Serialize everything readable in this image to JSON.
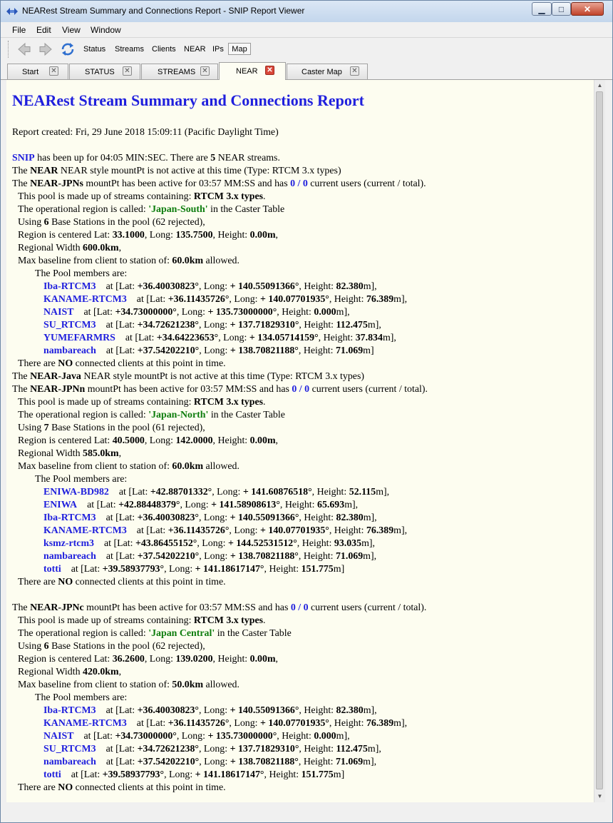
{
  "window": {
    "title": "NEARest Stream Summary and Connections Report - SNIP Report Viewer",
    "min_glyph": "▁",
    "max_glyph": "□",
    "close_glyph": "✕"
  },
  "menu": [
    "File",
    "Edit",
    "View",
    "Window"
  ],
  "toolbar": {
    "links": [
      "Status",
      "Streams",
      "Clients",
      "NEAR",
      "IPs"
    ],
    "map_label": "Map"
  },
  "tabs": [
    {
      "label": "Start",
      "active": false
    },
    {
      "label": "STATUS",
      "active": false
    },
    {
      "label": "STREAMS",
      "active": false
    },
    {
      "label": "NEAR",
      "active": true
    },
    {
      "label": "Caster Map",
      "active": false
    }
  ],
  "report": {
    "title": "NEARest Stream Summary and Connections Report",
    "created": "Report created: Fri, 29 June 2018 15:09:11 (Pacific Daylight Time)",
    "uptime": {
      "snip": "SNIP",
      "t1": " has been up for 04:05 MIN:SEC. There are ",
      "count": "5",
      "t2": " NEAR streams."
    },
    "inactive_near": {
      "a": "The ",
      "name": "NEAR",
      "b": " NEAR style mountPt is not active at this time (Type: RTCM 3.x types)"
    },
    "inactive_java": {
      "a": "The ",
      "name": "NEAR-Java",
      "b": " NEAR style mountPt is not active at this time (Type: RTCM 3.x types)"
    },
    "pools": [
      {
        "a": "The ",
        "name": "NEAR-JPNs",
        "b": " mountPt has been active for 03:57 MM:SS and has ",
        "users": "0 / 0",
        "c": " current users (current / total).",
        "types_a": "This pool is made up of streams containing: ",
        "types": "RTCM 3.x types",
        "types_b": ".",
        "region_a": "The operational region is called: ",
        "region": "'Japan-South'",
        "region_b": " in the Caster Table",
        "using_a": "Using ",
        "using_n": "6",
        "using_b": " Base Stations in the pool (62 rejected),",
        "center_a": "Region is centered Lat: ",
        "lat": "33.1000",
        "center_b": ", Long: ",
        "lon": "135.7500",
        "center_c": ", Height: ",
        "h": "0.00m",
        "center_d": ",",
        "width_a": "Regional Width ",
        "width": "600.0km",
        "width_b": ",",
        "base_a": "Max baseline from client to station of: ",
        "base": "60.0km",
        "base_b": " allowed.",
        "members_label": "The Pool members are:",
        "members": [
          {
            "name": "Iba-RTCM3",
            "lat": "+36.40030823°",
            "lon": "+ 140.55091366°",
            "h": "82.380",
            "end": "],"
          },
          {
            "name": "KANAME-RTCM3",
            "lat": "+36.11435726°",
            "lon": "+ 140.07701935°",
            "h": "76.389",
            "end": "],"
          },
          {
            "name": "NAIST",
            "lat": "+34.73000000°",
            "lon": "+ 135.73000000°",
            "h": "0.000",
            "end": "],"
          },
          {
            "name": "SU_RTCM3",
            "lat": "+34.72621238°",
            "lon": "+ 137.71829310°",
            "h": "112.475",
            "end": "],"
          },
          {
            "name": "YUMEFARMRS",
            "lat": "+34.64223653°",
            "lon": "+ 134.05714159°",
            "h": "37.834",
            "end": "],"
          },
          {
            "name": "nambareach",
            "lat": "+37.54202210°",
            "lon": "+ 138.70821188°",
            "h": "71.069",
            "end": "]"
          }
        ],
        "none_a": "There are ",
        "none": "NO",
        "none_b": " connected clients at this point in time."
      },
      {
        "a": "The ",
        "name": "NEAR-JPNn",
        "b": " mountPt has been active for 03:57 MM:SS and has ",
        "users": "0 / 0",
        "c": " current users (current / total).",
        "types_a": "This pool is made up of streams containing: ",
        "types": "RTCM 3.x types",
        "types_b": ".",
        "region_a": "The operational region is called: ",
        "region": "'Japan-North'",
        "region_b": " in the Caster Table",
        "using_a": "Using ",
        "using_n": "7",
        "using_b": " Base Stations in the pool (61 rejected),",
        "center_a": "Region is centered Lat: ",
        "lat": "40.5000",
        "center_b": ", Long: ",
        "lon": "142.0000",
        "center_c": ", Height: ",
        "h": "0.00m",
        "center_d": ",",
        "width_a": "Regional Width ",
        "width": "585.0km",
        "width_b": ",",
        "base_a": "Max baseline from client to station of: ",
        "base": "60.0km",
        "base_b": " allowed.",
        "members_label": "The Pool members are:",
        "members": [
          {
            "name": "ENIWA-BD982",
            "lat": "+42.88701332°",
            "lon": "+ 141.60876518°",
            "h": "52.115",
            "end": "],"
          },
          {
            "name": "ENIWA",
            "lat": "+42.88448379°",
            "lon": "+ 141.58908613°",
            "h": "65.693",
            "end": "],"
          },
          {
            "name": "Iba-RTCM3",
            "lat": "+36.40030823°",
            "lon": "+ 140.55091366°",
            "h": "82.380",
            "end": "],"
          },
          {
            "name": "KANAME-RTCM3",
            "lat": "+36.11435726°",
            "lon": "+ 140.07701935°",
            "h": "76.389",
            "end": "],"
          },
          {
            "name": "ksmz-rtcm3",
            "lat": "+43.86455152°",
            "lon": "+ 144.52531512°",
            "h": "93.035",
            "end": "],"
          },
          {
            "name": "nambareach",
            "lat": "+37.54202210°",
            "lon": "+ 138.70821188°",
            "h": "71.069",
            "end": "],"
          },
          {
            "name": "totti",
            "lat": "+39.58937793°",
            "lon": "+ 141.18617147°",
            "h": "151.775",
            "end": "]"
          }
        ],
        "none_a": "There are ",
        "none": "NO",
        "none_b": " connected clients at this point in time."
      },
      {
        "a": "The ",
        "name": "NEAR-JPNc",
        "b": " mountPt has been active for 03:57 MM:SS and has ",
        "users": "0 / 0",
        "c": " current users (current / total).",
        "types_a": "This pool is made up of streams containing: ",
        "types": "RTCM 3.x types",
        "types_b": ".",
        "region_a": "The operational region is called: ",
        "region": "'Japan Central'",
        "region_b": " in the Caster Table",
        "using_a": "Using ",
        "using_n": "6",
        "using_b": " Base Stations in the pool (62 rejected),",
        "center_a": "Region is centered Lat: ",
        "lat": "36.2600",
        "center_b": ", Long: ",
        "lon": "139.0200",
        "center_c": ", Height: ",
        "h": "0.00m",
        "center_d": ",",
        "width_a": "Regional Width ",
        "width": "420.0km",
        "width_b": ",",
        "base_a": "Max baseline from client to station of: ",
        "base": "50.0km",
        "base_b": " allowed.",
        "members_label": "The Pool members are:",
        "members": [
          {
            "name": "Iba-RTCM3",
            "lat": "+36.40030823°",
            "lon": "+ 140.55091366°",
            "h": "82.380",
            "end": "],"
          },
          {
            "name": "KANAME-RTCM3",
            "lat": "+36.11435726°",
            "lon": "+ 140.07701935°",
            "h": "76.389",
            "end": "],"
          },
          {
            "name": "NAIST",
            "lat": "+34.73000000°",
            "lon": "+ 135.73000000°",
            "h": "0.000",
            "end": "],"
          },
          {
            "name": "SU_RTCM3",
            "lat": "+34.72621238°",
            "lon": "+ 137.71829310°",
            "h": "112.475",
            "end": "],"
          },
          {
            "name": "nambareach",
            "lat": "+37.54202210°",
            "lon": "+ 138.70821188°",
            "h": "71.069",
            "end": "],"
          },
          {
            "name": "totti",
            "lat": "+39.58937793°",
            "lon": "+ 141.18617147°",
            "h": "151.775",
            "end": "]"
          }
        ],
        "none_a": "There are ",
        "none": "NO",
        "none_b": " connected clients at this point in time."
      }
    ],
    "member_text": {
      "at": "at [Lat: ",
      "long": ",  Long: ",
      "height": ",  Height: ",
      "unit": "m"
    }
  },
  "colors": {
    "link": "#1f1fdd",
    "region": "#0e7d0e",
    "page_bg": "#fdfdf0"
  }
}
